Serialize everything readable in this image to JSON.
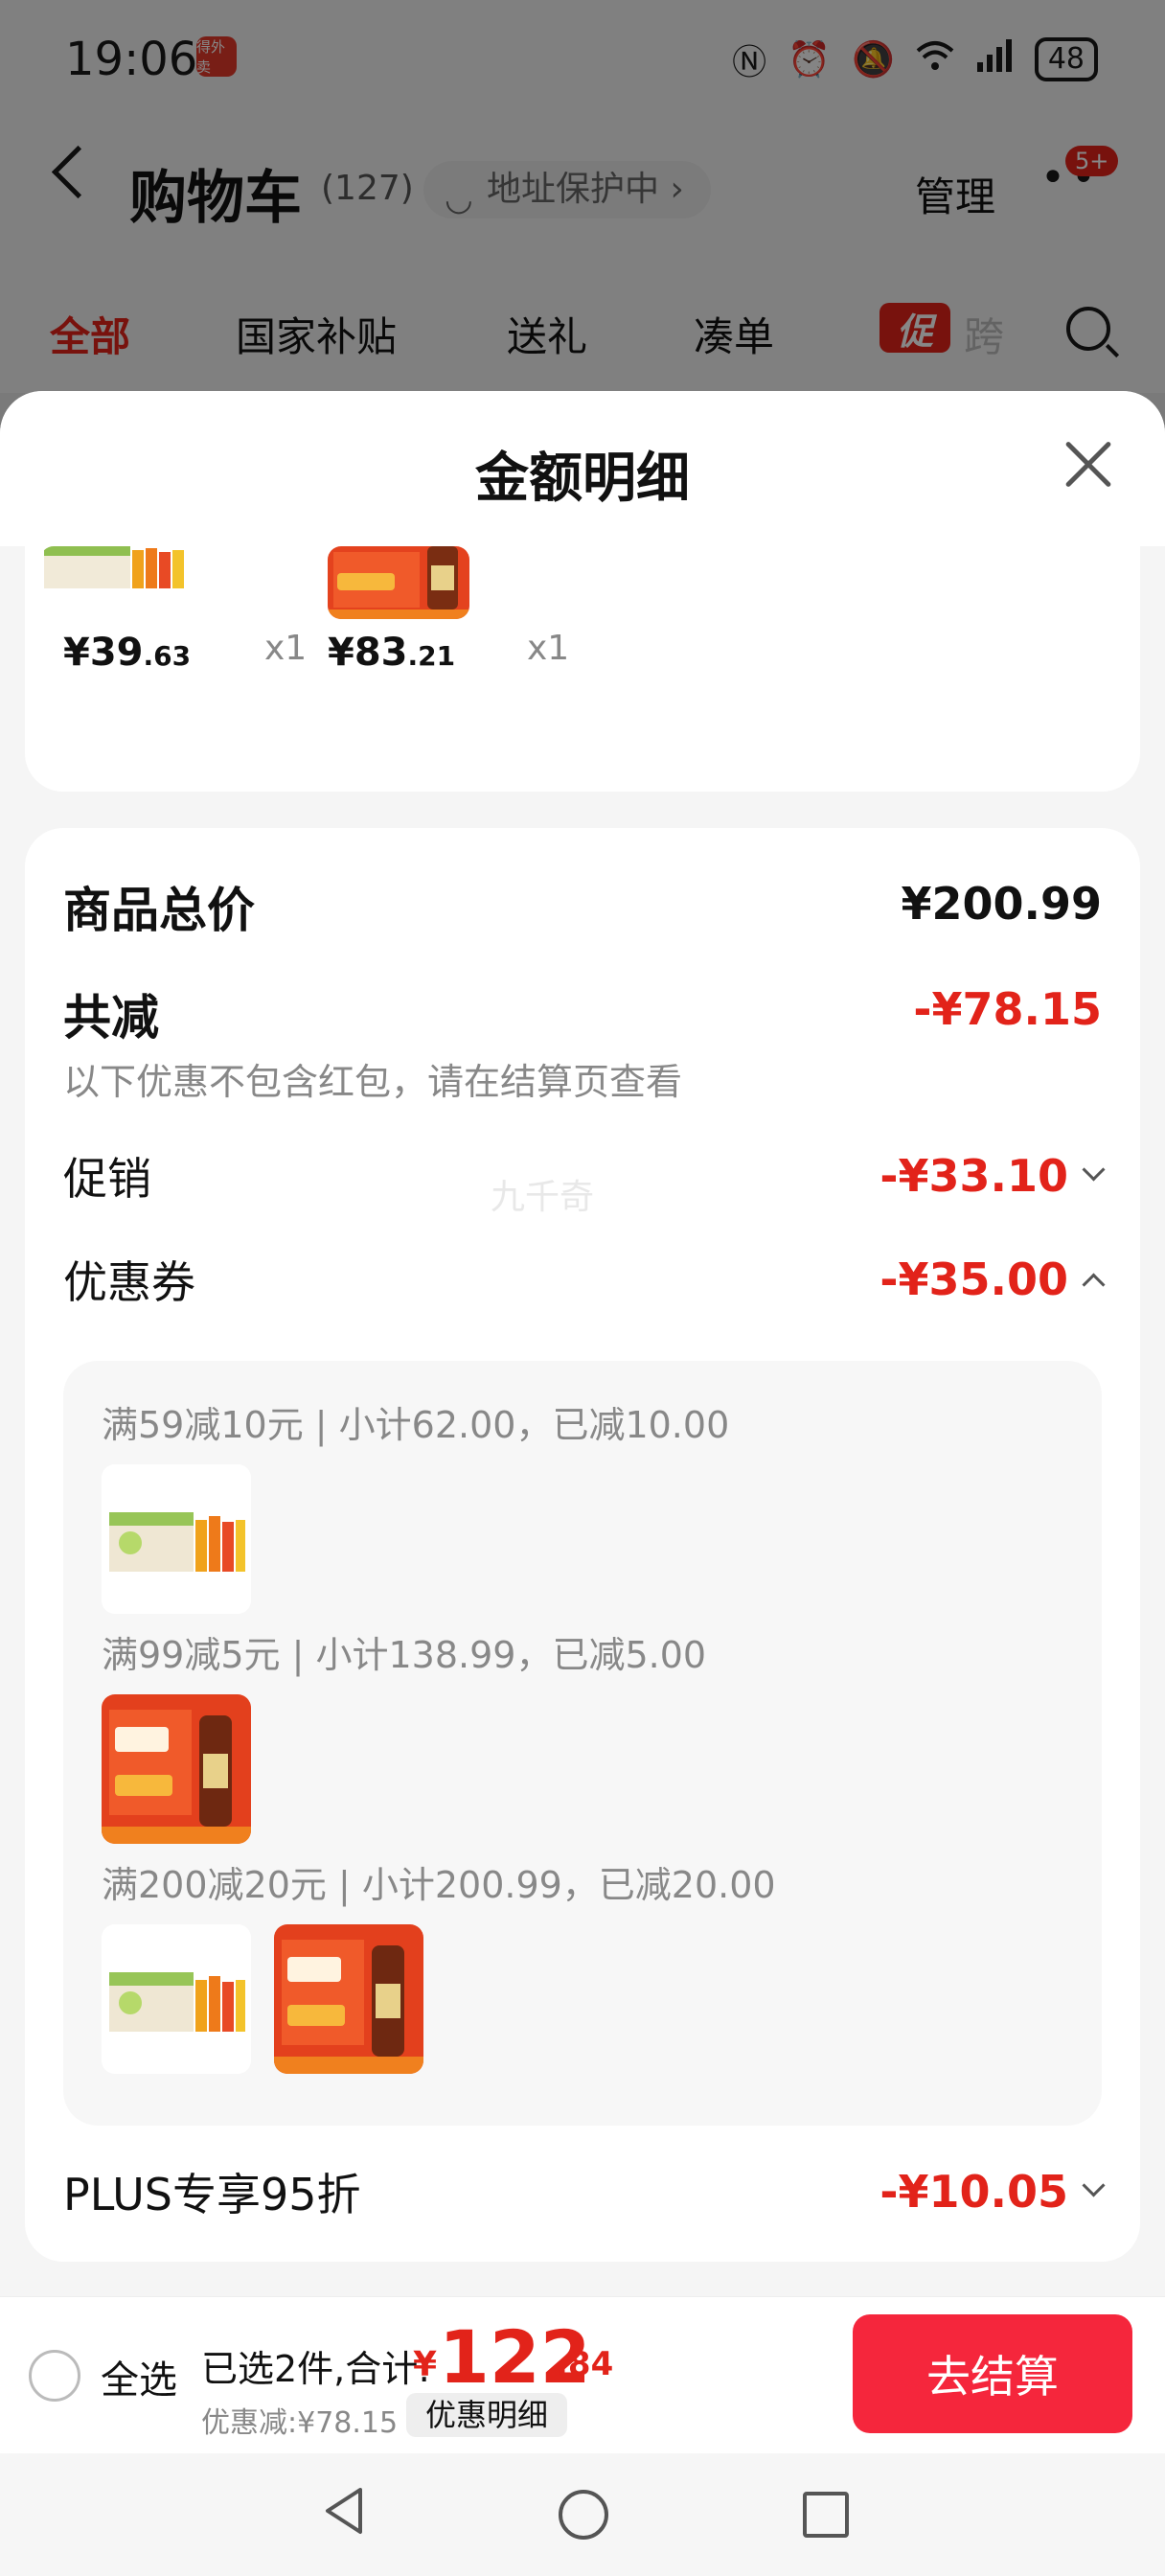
{
  "status_bar": {
    "time": "19:06",
    "app_badge": "得外卖",
    "battery": "48",
    "icons": [
      "nfc-icon",
      "alarm-icon",
      "mute-icon",
      "wifi-icon",
      "signal-icon"
    ]
  },
  "header": {
    "title": "购物车",
    "count": "(127)",
    "address_protect": "地址保护中",
    "manage": "管理",
    "more_badge": "5+"
  },
  "tabs": [
    {
      "label": "全部",
      "active": true
    },
    {
      "label": "国家补贴"
    },
    {
      "label": "送礼"
    },
    {
      "label": "凑单"
    },
    {
      "label": "促",
      "type": "promo-tag"
    },
    {
      "label": "跨"
    }
  ],
  "sheet": {
    "title": "金额明细",
    "items": [
      {
        "price_int": "¥39",
        "price_dec": ".63",
        "qty": "x1"
      },
      {
        "price_int": "¥83",
        "price_dec": ".21",
        "qty": "x1"
      }
    ],
    "total": {
      "label": "商品总价",
      "value": "¥200.99"
    },
    "reduction": {
      "label": "共减",
      "value": "-¥78.15",
      "note": "以下优惠不包含红包，请在结算页查看"
    },
    "promotion": {
      "label": "促销",
      "value": "-¥33.10"
    },
    "coupon": {
      "label": "优惠券",
      "value": "-¥35.00",
      "rules": [
        {
          "text": "满59减10元 | 小计62.00，已减10.00"
        },
        {
          "text": "满99减5元 | 小计138.99，已减5.00"
        },
        {
          "text": "满200减20元 | 小计200.99，已减20.00"
        }
      ]
    },
    "plus": {
      "label": "PLUS专享95折",
      "value": "-¥10.05"
    },
    "watermark": "九千奇"
  },
  "footer": {
    "select_all": "全选",
    "selected_sum_label": "已选2件,合计:",
    "sum_yen": "¥",
    "sum_int": "122",
    "sum_dec": ".84",
    "discount": "优惠减:¥78.15",
    "detail_btn": "优惠明细",
    "checkout": "去结算"
  },
  "colors": {
    "accent_red": "#e2231a",
    "checkout_red": "#f5263c"
  }
}
